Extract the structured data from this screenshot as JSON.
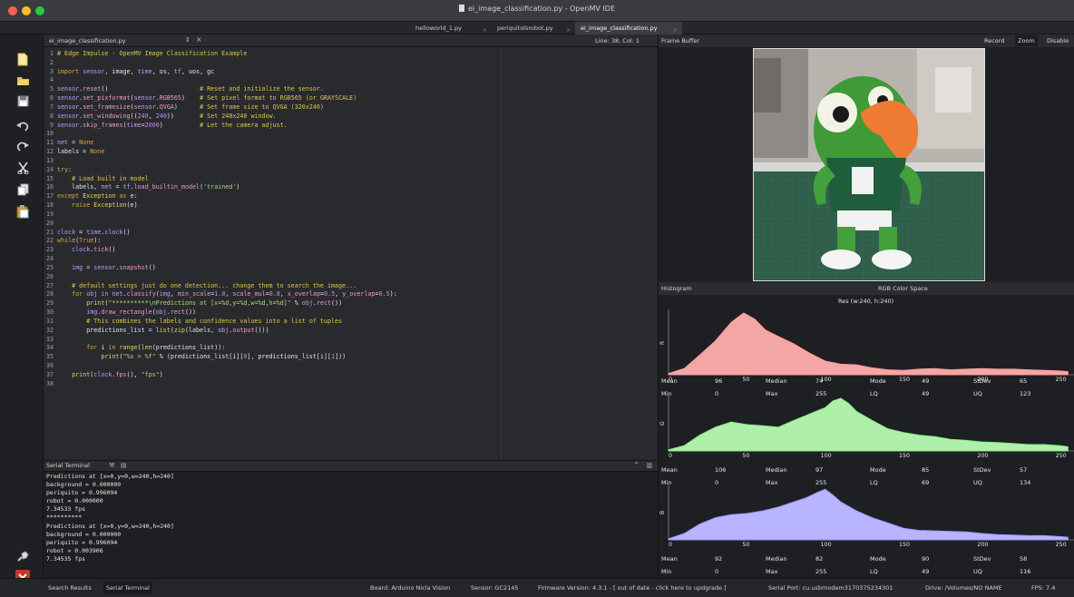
{
  "window": {
    "title": "ei_image_classification.py - OpenMV IDE",
    "colors": {
      "close": "#fe5f57",
      "minimize": "#febc2e",
      "zoom": "#28c840"
    }
  },
  "tabs": [
    "helloworld_1.py",
    "periquitolsrobot.py",
    "ei_image_classification.py"
  ],
  "toolbar_icons": [
    "new-file-icon",
    "open-file-icon",
    "save-icon",
    "undo-icon",
    "redo-icon",
    "cut-icon",
    "copy-icon",
    "paste-icon",
    "connect-icon",
    "stop-icon"
  ],
  "editor": {
    "file_tab": "ei_image_classification.py",
    "line_col": "Line: 38, Col: 1",
    "lines": [
      "# Edge Impulse - OpenMV Image Classification Example",
      "",
      "import sensor, image, time, os, tf, uos, gc",
      "",
      "sensor.reset()                         # Reset and initialize the sensor.",
      "sensor.set_pixformat(sensor.RGB565)    # Set pixel format to RGB565 (or GRAYSCALE)",
      "sensor.set_framesize(sensor.QVGA)      # Set frame size to QVGA (320x240)",
      "sensor.set_windowing((240, 240))       # Set 240x240 window.",
      "sensor.skip_frames(time=2000)          # Let the camera adjust.",
      "",
      "net = None",
      "labels = None",
      "",
      "try:",
      "    # Load built in model",
      "    labels, net = tf.load_builtin_model('trained')",
      "except Exception as e:",
      "    raise Exception(e)",
      "",
      "",
      "clock = time.clock()",
      "while(True):",
      "    clock.tick()",
      "",
      "    img = sensor.snapshot()",
      "",
      "    # default settings just do one detection... change them to search the image...",
      "    for obj in net.classify(img, min_scale=1.0, scale_mul=0.8, x_overlap=0.5, y_overlap=0.5):",
      "        print(\"**********\\nPredictions at [x=%d,y=%d,w=%d,h=%d]\" % obj.rect())",
      "        img.draw_rectangle(obj.rect())",
      "        # This combines the labels and confidence values into a list of tuples",
      "        predictions_list = list(zip(labels, obj.output()))",
      "",
      "        for i in range(len(predictions_list)):",
      "            print(\"%s = %f\" % (predictions_list[i][0], predictions_list[i][1]))",
      "",
      "    print(clock.fps(), \"fps\")",
      ""
    ]
  },
  "serial_terminal": {
    "title": "Serial Terminal",
    "lines": [
      "Predictions at [x=0,y=0,w=240,h=240]",
      "background = 0.000000",
      "periquito = 0.996094",
      "robot = 0.000000",
      "7.34533 fps",
      "**********",
      "Predictions at [x=0,y=0,w=240,h=240]",
      "background = 0.000000",
      "periquito = 0.996094",
      "robot = 0.003906",
      "7.34535 fps"
    ]
  },
  "frame_buffer": {
    "title": "Frame Buffer",
    "buttons": [
      "Record",
      "Zoom",
      "Disable"
    ]
  },
  "histogram": {
    "title": "Histogram",
    "color_space": "RGB Color Space",
    "resolution": "Res (w:240, h:240)",
    "x_ticks": [
      "0",
      "50",
      "100",
      "150",
      "200",
      "250"
    ],
    "channels": [
      {
        "name": "R",
        "fill": "#f4a6a6",
        "stroke": "#ff9999",
        "stats": {
          "Mean": "96",
          "Median": "74",
          "Mode": "49",
          "StDev": "65",
          "Min": "0",
          "Max": "255",
          "LQ": "49",
          "UQ": "123"
        }
      },
      {
        "name": "G",
        "fill": "#aef0aa",
        "stroke": "#88ee88",
        "stats": {
          "Mean": "106",
          "Median": "97",
          "Mode": "85",
          "StDev": "57",
          "Min": "0",
          "Max": "255",
          "LQ": "69",
          "UQ": "134"
        }
      },
      {
        "name": "B",
        "fill": "#b9b4ff",
        "stroke": "#9c97ff",
        "stats": {
          "Mean": "92",
          "Median": "82",
          "Mode": "90",
          "StDev": "58",
          "Min": "0",
          "Max": "255",
          "LQ": "49",
          "UQ": "116"
        }
      }
    ],
    "curves": [
      [
        [
          0,
          0.02
        ],
        [
          10,
          0.1
        ],
        [
          20,
          0.32
        ],
        [
          30,
          0.55
        ],
        [
          40,
          0.85
        ],
        [
          48,
          1.0
        ],
        [
          55,
          0.9
        ],
        [
          62,
          0.72
        ],
        [
          70,
          0.62
        ],
        [
          80,
          0.5
        ],
        [
          90,
          0.35
        ],
        [
          100,
          0.22
        ],
        [
          110,
          0.17
        ],
        [
          120,
          0.16
        ],
        [
          130,
          0.11
        ],
        [
          140,
          0.08
        ],
        [
          150,
          0.07
        ],
        [
          160,
          0.09
        ],
        [
          170,
          0.1
        ],
        [
          180,
          0.08
        ],
        [
          190,
          0.09
        ],
        [
          200,
          0.1
        ],
        [
          210,
          0.09
        ],
        [
          220,
          0.09
        ],
        [
          230,
          0.08
        ],
        [
          240,
          0.07
        ],
        [
          250,
          0.06
        ],
        [
          255,
          0.05
        ]
      ],
      [
        [
          0,
          0.02
        ],
        [
          10,
          0.1
        ],
        [
          20,
          0.3
        ],
        [
          30,
          0.45
        ],
        [
          40,
          0.55
        ],
        [
          50,
          0.5
        ],
        [
          60,
          0.48
        ],
        [
          70,
          0.45
        ],
        [
          80,
          0.58
        ],
        [
          90,
          0.7
        ],
        [
          100,
          0.82
        ],
        [
          105,
          0.95
        ],
        [
          110,
          1.0
        ],
        [
          115,
          0.9
        ],
        [
          120,
          0.75
        ],
        [
          130,
          0.58
        ],
        [
          140,
          0.42
        ],
        [
          150,
          0.35
        ],
        [
          160,
          0.3
        ],
        [
          170,
          0.27
        ],
        [
          180,
          0.22
        ],
        [
          190,
          0.2
        ],
        [
          200,
          0.17
        ],
        [
          210,
          0.16
        ],
        [
          220,
          0.14
        ],
        [
          230,
          0.12
        ],
        [
          240,
          0.12
        ],
        [
          250,
          0.1
        ],
        [
          255,
          0.08
        ]
      ],
      [
        [
          0,
          0.02
        ],
        [
          10,
          0.12
        ],
        [
          20,
          0.3
        ],
        [
          30,
          0.42
        ],
        [
          40,
          0.48
        ],
        [
          50,
          0.5
        ],
        [
          60,
          0.55
        ],
        [
          70,
          0.62
        ],
        [
          80,
          0.72
        ],
        [
          88,
          0.8
        ],
        [
          95,
          0.9
        ],
        [
          100,
          0.96
        ],
        [
          105,
          0.85
        ],
        [
          110,
          0.72
        ],
        [
          120,
          0.55
        ],
        [
          130,
          0.42
        ],
        [
          140,
          0.32
        ],
        [
          150,
          0.22
        ],
        [
          160,
          0.18
        ],
        [
          170,
          0.17
        ],
        [
          180,
          0.16
        ],
        [
          190,
          0.15
        ],
        [
          200,
          0.12
        ],
        [
          210,
          0.1
        ],
        [
          220,
          0.09
        ],
        [
          230,
          0.08
        ],
        [
          240,
          0.08
        ],
        [
          250,
          0.06
        ],
        [
          255,
          0.05
        ]
      ]
    ]
  },
  "status_bar": {
    "tabs": [
      "Search Results",
      "Serial Terminal"
    ],
    "board": "Board: Arduino Nicla Vision",
    "sensor": "Sensor: GC2145",
    "firmware": "Firmware Version: 4.3.1 - [ out of date - click here to updgrade ]",
    "serial_port": "Serial Port: cu.usbmodem3170375234301",
    "drive": "Drive: /Volumes/NO NAME",
    "fps": "FPS: 7.4"
  }
}
